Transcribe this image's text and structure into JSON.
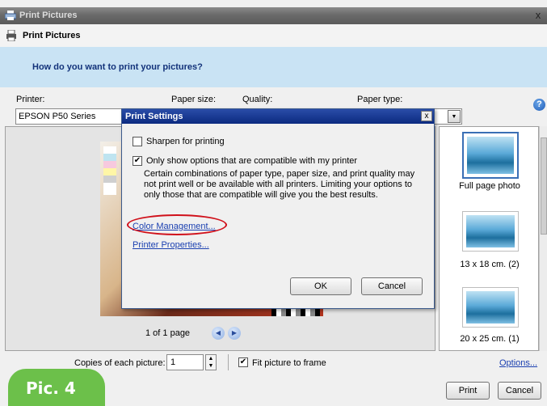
{
  "window": {
    "title": "Print Pictures",
    "close_glyph": "x"
  },
  "header": {
    "title": "Print Pictures"
  },
  "banner": {
    "question": "How do you want to print your pictures?"
  },
  "labels": {
    "printer": "Printer:",
    "paper_size": "Paper size:",
    "quality": "Quality:",
    "paper_type": "Paper type:"
  },
  "printer": {
    "value": "EPSON P50 Series"
  },
  "help": {
    "glyph": "?"
  },
  "preview": {
    "page_indicator": "1 of 1 page"
  },
  "thumbnails": {
    "items": [
      {
        "caption": "Full page photo",
        "selected": true
      },
      {
        "caption": "13 x 18 cm. (2)",
        "selected": false
      },
      {
        "caption": "20 x 25 cm. (1)",
        "selected": false
      }
    ]
  },
  "bottom": {
    "copies_label": "Copies of each picture:",
    "copies_value": "1",
    "fit_label": "Fit picture to frame",
    "fit_checked": true,
    "options_link": "Options..."
  },
  "buttons": {
    "print": "Print",
    "cancel": "Cancel"
  },
  "badge": {
    "text": "Pic. 4",
    "color": "#6cc04a"
  },
  "dialog": {
    "title": "Print Settings",
    "close_glyph": "x",
    "sharpen_label": "Sharpen for printing",
    "sharpen_checked": false,
    "compatible_label": "Only show options that are compatible with my printer",
    "compatible_checked": true,
    "description_lines": [
      "Certain combinations of paper type, paper size, and print quality may",
      "not print well or be available with all printers.  Limiting your options to",
      "only those that are compatible will give you the best results."
    ],
    "color_management_link": "Color Management...",
    "printer_properties_link": "Printer Properties...",
    "ok": "OK",
    "cancel": "Cancel",
    "highlight_color": "#d0101a"
  },
  "checkmark": "✔"
}
